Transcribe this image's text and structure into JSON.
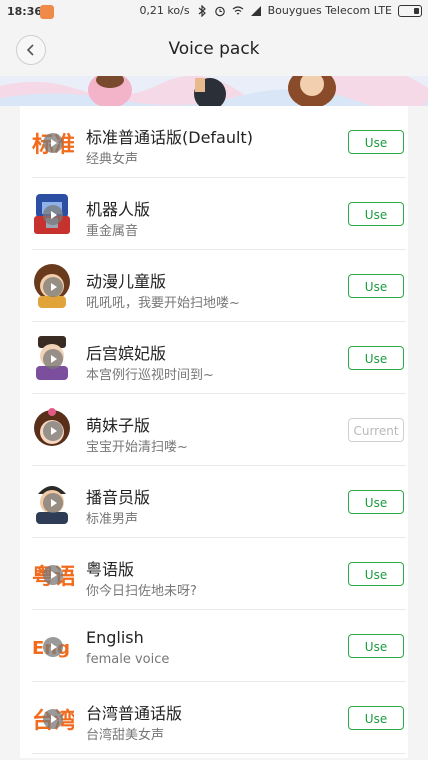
{
  "status": {
    "time": "18:36",
    "speed": "0,21 ko/s",
    "carrier": "Bouygues Telecom LTE"
  },
  "header": {
    "title": "Voice pack"
  },
  "items": [
    {
      "name": "标准普通话版(Default)",
      "desc": "经典女声",
      "button": "Use",
      "avatar": "standard-mandarin-logo"
    },
    {
      "name": "机器人版",
      "desc": "重金属音",
      "button": "Use",
      "avatar": "robot-avatar"
    },
    {
      "name": "动漫儿童版",
      "desc": "吼吼吼，我要开始扫地喽~",
      "button": "Use",
      "avatar": "kid-avatar"
    },
    {
      "name": "后宫嫔妃版",
      "desc": "本宫例行巡视时间到~",
      "button": "Use",
      "avatar": "consort-avatar"
    },
    {
      "name": "萌妹子版",
      "desc": "宝宝开始清扫喽~",
      "button": "Current",
      "avatar": "cute-girl-avatar"
    },
    {
      "name": "播音员版",
      "desc": "标准男声",
      "button": "Use",
      "avatar": "announcer-avatar"
    },
    {
      "name": "粤语版",
      "desc": "你今日扫佐地未呀?",
      "button": "Use",
      "avatar": "cantonese-logo"
    },
    {
      "name": "English",
      "desc": "female voice",
      "button": "Use",
      "avatar": "english-logo"
    },
    {
      "name": "台湾普通话版",
      "desc": "台湾甜美女声",
      "button": "Use",
      "avatar": "taiwan-mandarin-logo"
    }
  ],
  "colors": {
    "accent": "#2aa84a",
    "disabled": "#cfcfcf",
    "logo": "#f26b1d"
  }
}
